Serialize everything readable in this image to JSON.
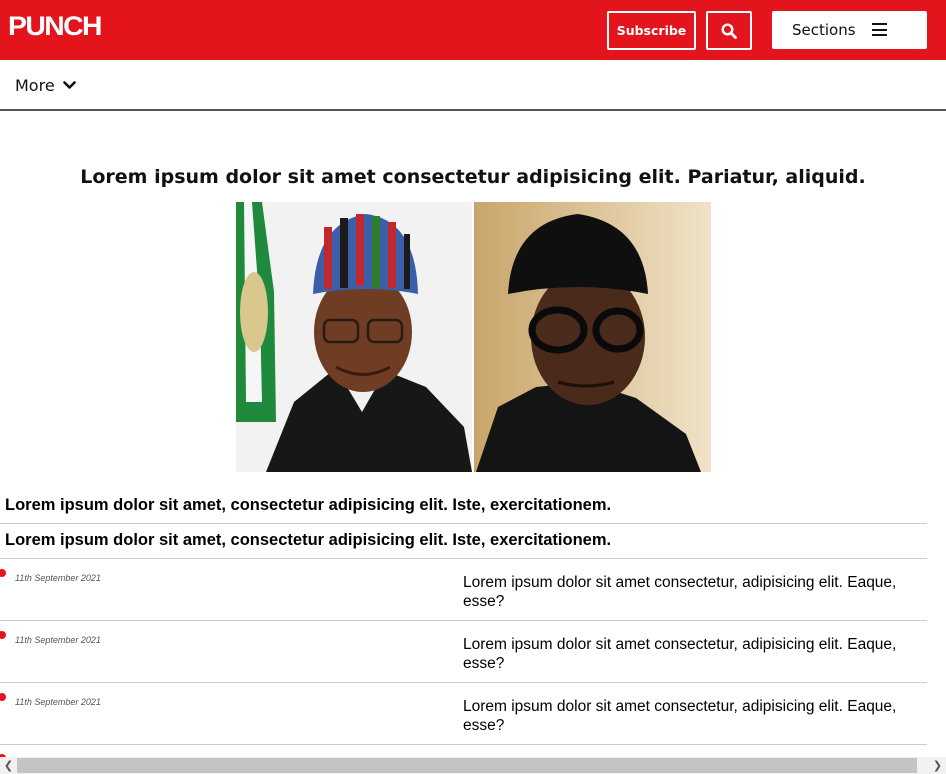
{
  "header": {
    "logo": "PUNCH",
    "subscribe_label": "Subscribe",
    "search_icon": "search-icon",
    "sections_label": "Sections",
    "menu_icon": "hamburger-icon",
    "brand_color": "#e3141c"
  },
  "nav": {
    "more_label": "More",
    "more_icon": "chevron-down-icon"
  },
  "main": {
    "headline": "Lorem ipsum dolor sit amet consectetur adipisicing elit. Pariatur, aliquid.",
    "subheadlines": [
      "Lorem ipsum dolor sit amet, consectetur adipisicing elit. Iste, exercitationem.",
      "Lorem ipsum dolor sit amet, consectetur adipisicing elit. Iste, exercitationem."
    ],
    "items": [
      {
        "date": "11th September 2021",
        "text": "Lorem ipsum dolor sit amet consectetur, adipisicing elit. Eaque, esse?"
      },
      {
        "date": "11th September 2021",
        "text": "Lorem ipsum dolor sit amet consectetur, adipisicing elit. Eaque, esse?"
      },
      {
        "date": "11th September 2021",
        "text": "Lorem ipsum dolor sit amet consectetur, adipisicing elit. Eaque, esse?"
      }
    ]
  },
  "scrollbar": {
    "left_icon": "scroll-left-icon",
    "right_icon": "scroll-right-icon"
  }
}
